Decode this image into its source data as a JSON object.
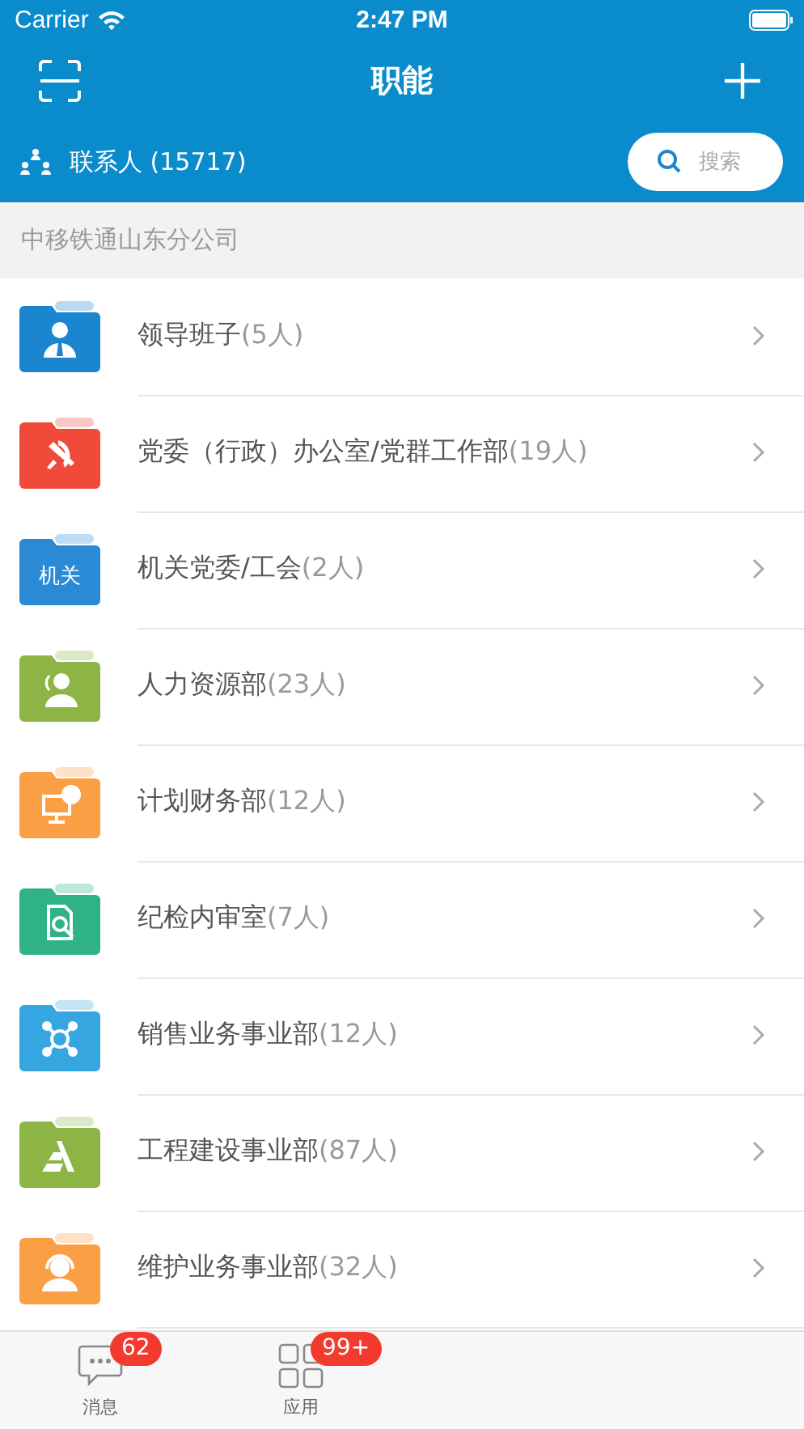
{
  "status_bar": {
    "carrier": "Carrier",
    "time": "2:47 PM"
  },
  "nav": {
    "title": "职能"
  },
  "contacts": {
    "label": "联系人 (15717)",
    "search_placeholder": "搜索"
  },
  "section": {
    "title": "中移铁通山东分公司"
  },
  "departments": [
    {
      "name": "领导班子",
      "count": "(5人)",
      "color": "#1a86d0",
      "kind": "leader"
    },
    {
      "name": "党委（行政）办公室/党群工作部",
      "count": "(19人)",
      "color": "#f04a3a",
      "kind": "party"
    },
    {
      "name": "机关党委/工会",
      "count": "(2人)",
      "color": "#2a8ad6",
      "kind": "text",
      "icon_text": "机关"
    },
    {
      "name": "人力资源部",
      "count": "(23人)",
      "color": "#8cb545",
      "kind": "people"
    },
    {
      "name": "计划财务部",
      "count": "(12人)",
      "color": "#fb9f45",
      "kind": "finance"
    },
    {
      "name": "纪检内审室",
      "count": "(7人)",
      "color": "#2fb386",
      "kind": "inspect"
    },
    {
      "name": "销售业务事业部",
      "count": "(12人)",
      "color": "#35a6e0",
      "kind": "network"
    },
    {
      "name": "工程建设事业部",
      "count": "(87人)",
      "color": "#8cb545",
      "kind": "pyramid"
    },
    {
      "name": "维护业务事业部",
      "count": "(32人)",
      "color": "#fb9f45",
      "kind": "headset"
    }
  ],
  "tab_bar": [
    {
      "label": "消息",
      "badge": "62",
      "kind": "chat"
    },
    {
      "label": "应用",
      "badge": "99+",
      "kind": "grid"
    }
  ]
}
